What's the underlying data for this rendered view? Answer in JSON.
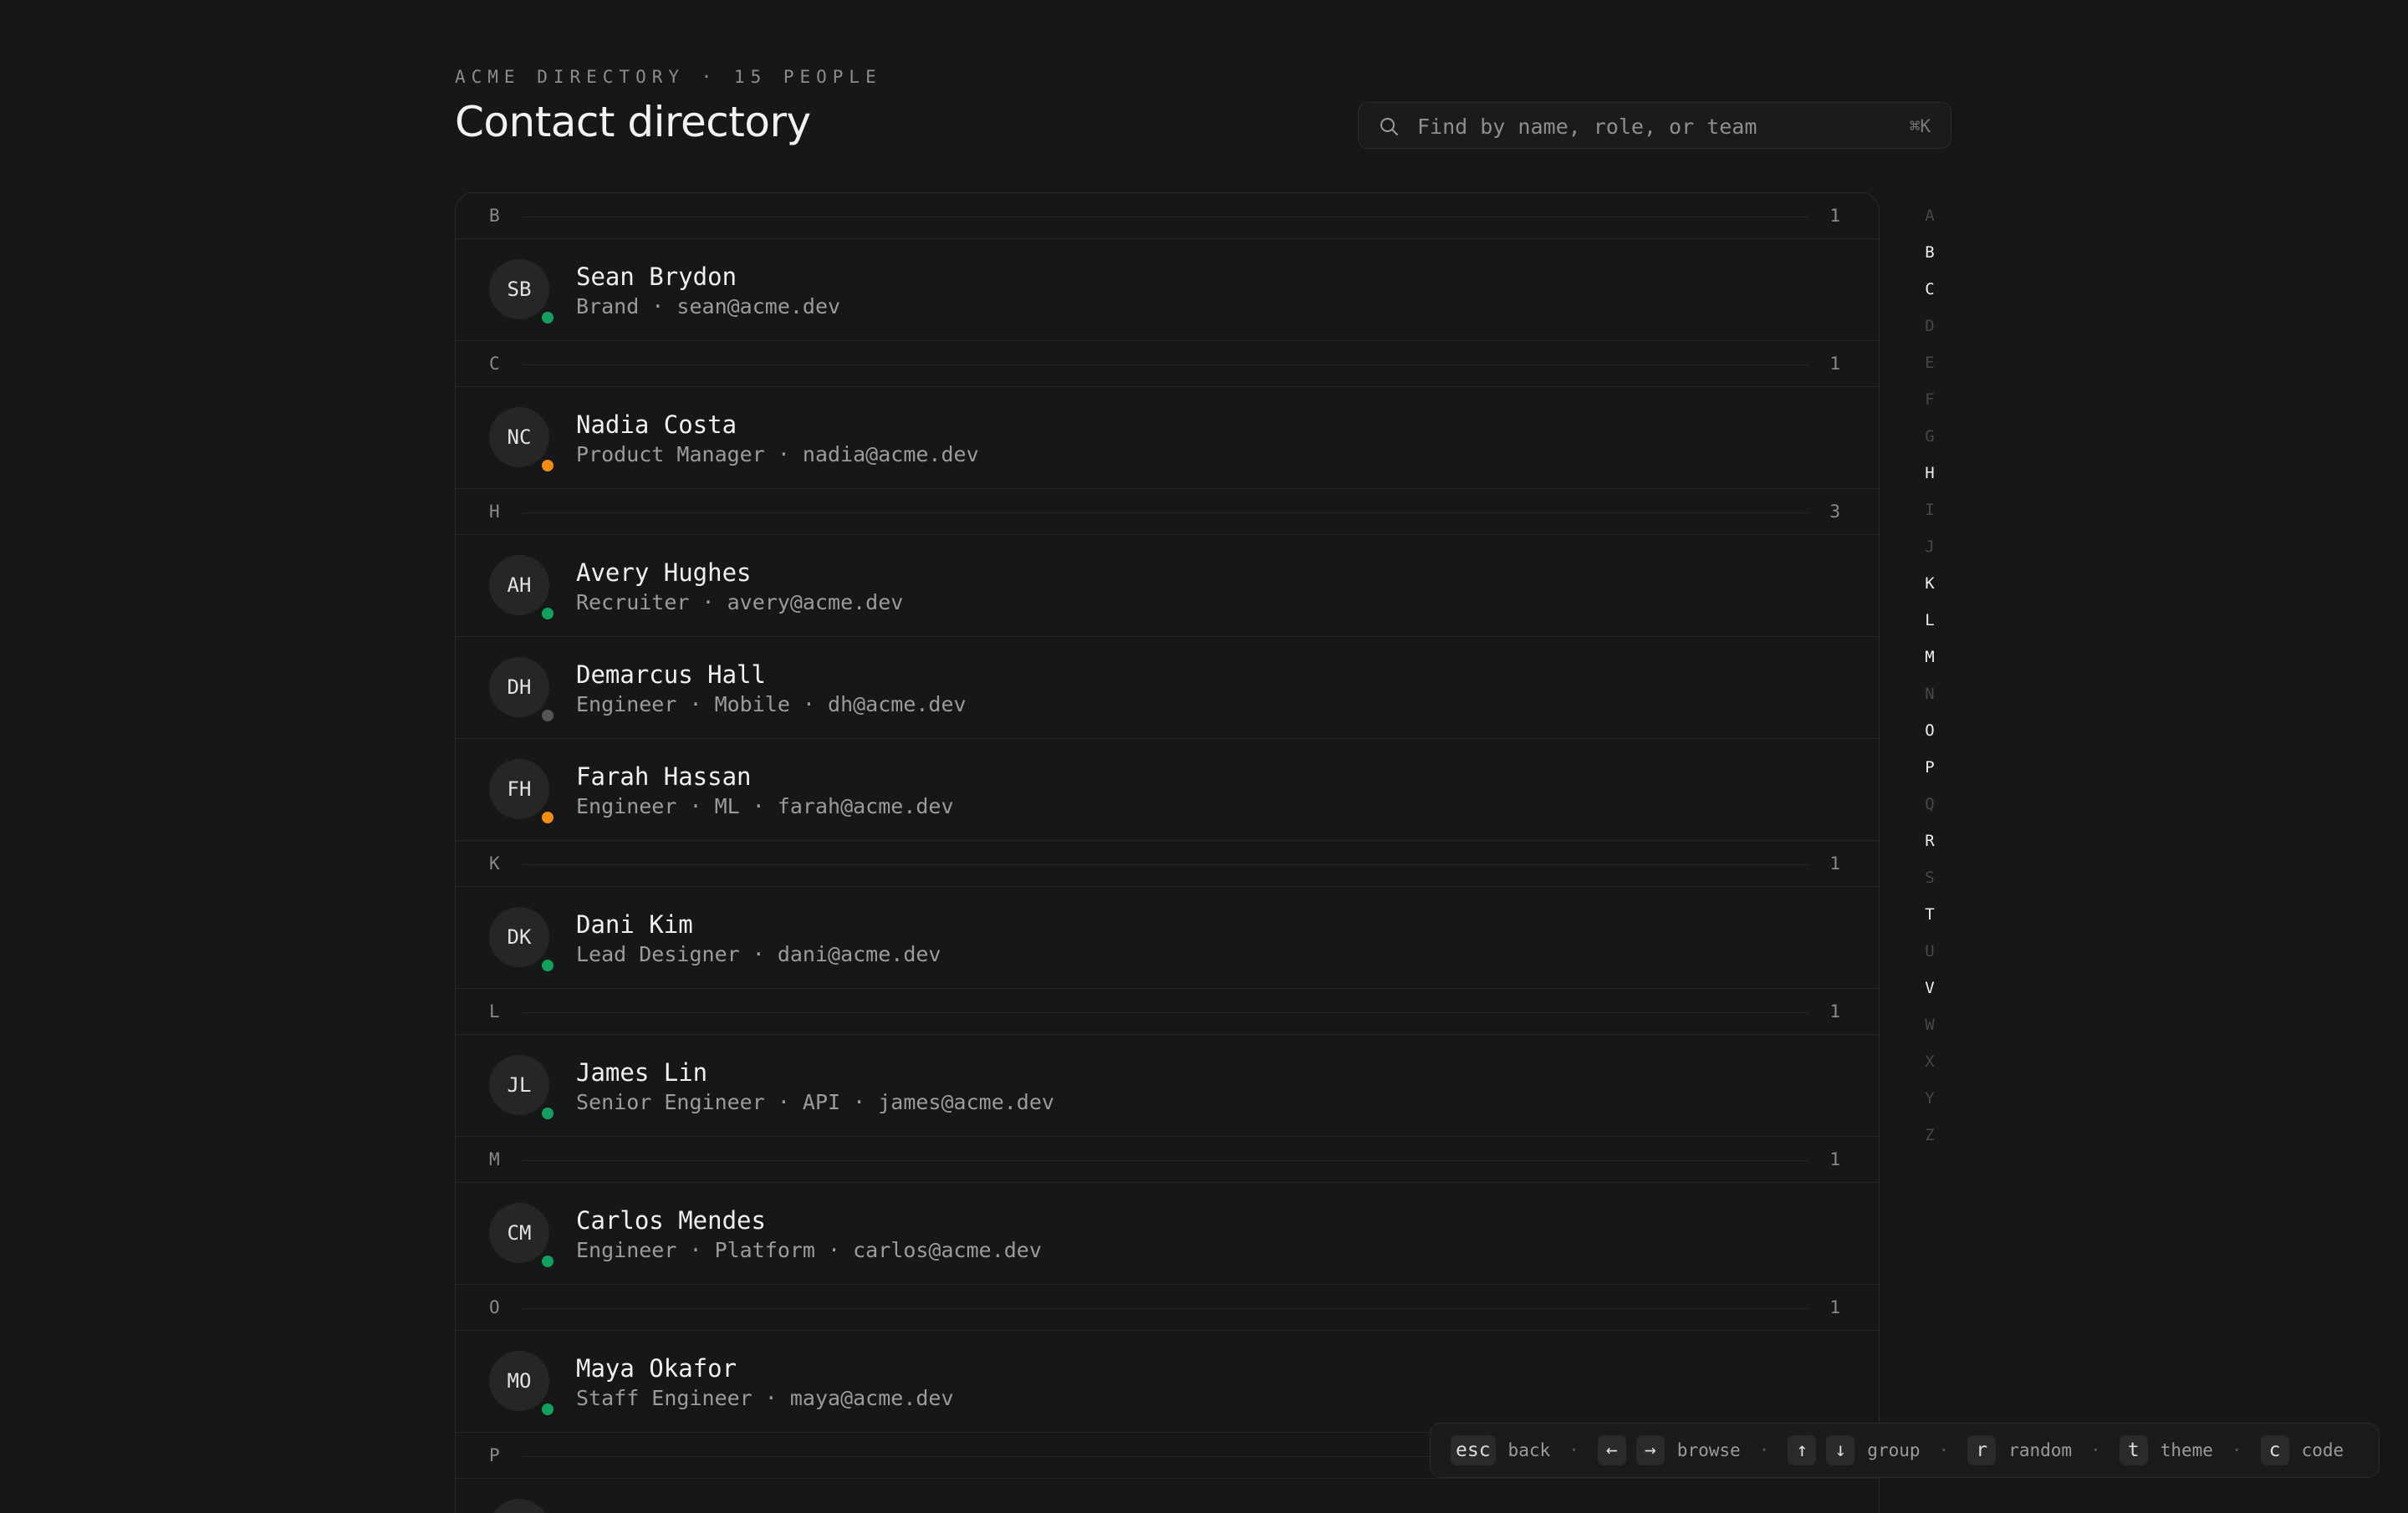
{
  "header": {
    "eyebrow": "ACME DIRECTORY · 15 PEOPLE",
    "title": "Contact directory"
  },
  "search": {
    "placeholder": "Find by name, role, or team",
    "shortcut": "⌘K",
    "icon": "search-icon"
  },
  "groups": [
    {
      "letter": "B",
      "count": "1",
      "people": [
        {
          "initials": "SB",
          "name": "Sean Brydon",
          "meta": "Brand · sean@acme.dev",
          "status": "online"
        }
      ]
    },
    {
      "letter": "C",
      "count": "1",
      "people": [
        {
          "initials": "NC",
          "name": "Nadia Costa",
          "meta": "Product Manager · nadia@acme.dev",
          "status": "away"
        }
      ]
    },
    {
      "letter": "H",
      "count": "3",
      "people": [
        {
          "initials": "AH",
          "name": "Avery Hughes",
          "meta": "Recruiter · avery@acme.dev",
          "status": "online"
        },
        {
          "initials": "DH",
          "name": "Demarcus Hall",
          "meta": "Engineer · Mobile · dh@acme.dev",
          "status": "offline"
        },
        {
          "initials": "FH",
          "name": "Farah Hassan",
          "meta": "Engineer · ML · farah@acme.dev",
          "status": "away"
        }
      ]
    },
    {
      "letter": "K",
      "count": "1",
      "people": [
        {
          "initials": "DK",
          "name": "Dani Kim",
          "meta": "Lead Designer · dani@acme.dev",
          "status": "online"
        }
      ]
    },
    {
      "letter": "L",
      "count": "1",
      "people": [
        {
          "initials": "JL",
          "name": "James Lin",
          "meta": "Senior Engineer · API · james@acme.dev",
          "status": "online"
        }
      ]
    },
    {
      "letter": "M",
      "count": "1",
      "people": [
        {
          "initials": "CM",
          "name": "Carlos Mendes",
          "meta": "Engineer · Platform · carlos@acme.dev",
          "status": "online"
        }
      ]
    },
    {
      "letter": "O",
      "count": "1",
      "people": [
        {
          "initials": "MO",
          "name": "Maya Okafor",
          "meta": "Staff Engineer · maya@acme.dev",
          "status": "online"
        }
      ]
    },
    {
      "letter": "P",
      "count": "",
      "people": []
    }
  ],
  "alphabet": [
    {
      "letter": "A",
      "active": false
    },
    {
      "letter": "B",
      "active": true
    },
    {
      "letter": "C",
      "active": true
    },
    {
      "letter": "D",
      "active": false
    },
    {
      "letter": "E",
      "active": false
    },
    {
      "letter": "F",
      "active": false
    },
    {
      "letter": "G",
      "active": false
    },
    {
      "letter": "H",
      "active": true
    },
    {
      "letter": "I",
      "active": false
    },
    {
      "letter": "J",
      "active": false
    },
    {
      "letter": "K",
      "active": true
    },
    {
      "letter": "L",
      "active": true
    },
    {
      "letter": "M",
      "active": true
    },
    {
      "letter": "N",
      "active": false
    },
    {
      "letter": "O",
      "active": true
    },
    {
      "letter": "P",
      "active": true
    },
    {
      "letter": "Q",
      "active": false
    },
    {
      "letter": "R",
      "active": true
    },
    {
      "letter": "S",
      "active": false
    },
    {
      "letter": "T",
      "active": true
    },
    {
      "letter": "U",
      "active": false
    },
    {
      "letter": "V",
      "active": true
    },
    {
      "letter": "W",
      "active": false
    },
    {
      "letter": "X",
      "active": false
    },
    {
      "letter": "Y",
      "active": false
    },
    {
      "letter": "Z",
      "active": false
    }
  ],
  "hints": [
    {
      "keys": [
        "esc"
      ],
      "label": "back"
    },
    {
      "keys": [
        "←",
        "→"
      ],
      "label": "browse"
    },
    {
      "keys": [
        "↑",
        "↓"
      ],
      "label": "group"
    },
    {
      "keys": [
        "r"
      ],
      "label": "random"
    },
    {
      "keys": [
        "t"
      ],
      "label": "theme"
    },
    {
      "keys": [
        "c"
      ],
      "label": "code"
    }
  ],
  "colors": {
    "background": "#171717",
    "online": "#12a05e",
    "away": "#f08c14",
    "offline": "#555555"
  }
}
